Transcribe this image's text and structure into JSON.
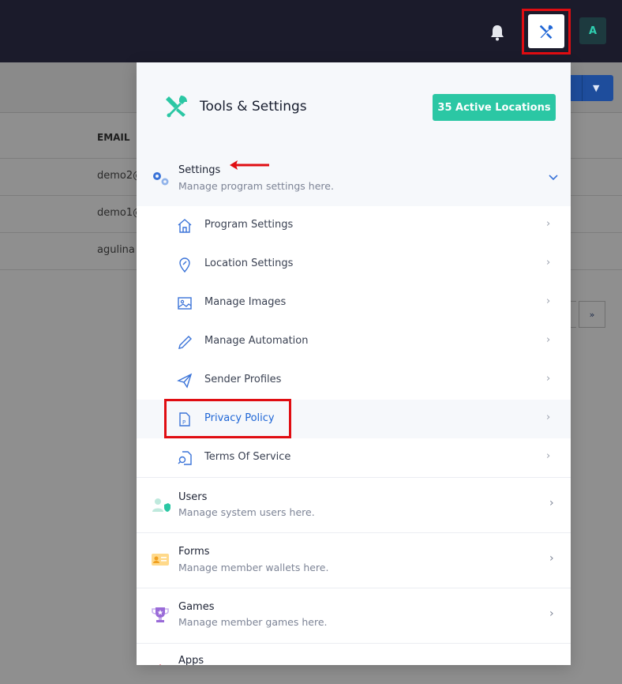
{
  "topbar": {
    "avatar_letter": "A",
    "icons": [
      "bell-icon",
      "tools-icon"
    ]
  },
  "background": {
    "table_header": "EMAIL",
    "rows": [
      "demo2@",
      "demo1@",
      "agulina"
    ],
    "pagination_next": "»"
  },
  "panel": {
    "title": "Tools & Settings",
    "badge": "35 Active Locations",
    "settings": {
      "title": "Settings",
      "description": "Manage program settings here.",
      "items": [
        {
          "label": "Program Settings",
          "icon": "home-icon"
        },
        {
          "label": "Location Settings",
          "icon": "map-pin-icon"
        },
        {
          "label": "Manage Images",
          "icon": "image-icon"
        },
        {
          "label": "Manage Automation",
          "icon": "pencil-icon"
        },
        {
          "label": "Sender Profiles",
          "icon": "send-icon"
        },
        {
          "label": "Privacy Policy",
          "icon": "document-p-icon"
        },
        {
          "label": "Terms Of Service",
          "icon": "document-search-icon"
        }
      ]
    },
    "users": {
      "title": "Users",
      "description": "Manage system users here."
    },
    "forms": {
      "title": "Forms",
      "description": "Manage member wallets here."
    },
    "games": {
      "title": "Games",
      "description": "Manage member games here."
    },
    "apps": {
      "title": "Apps"
    }
  },
  "colors": {
    "accent_teal": "#2bc7a4",
    "link_blue": "#1f66d6",
    "highlight_red": "#e00d12",
    "topbar": "#1b1b2b"
  }
}
